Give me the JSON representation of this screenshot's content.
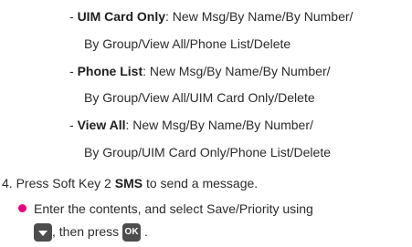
{
  "items": [
    {
      "term": "UIM Card Only",
      "line1": ": New Msg/By Name/By Number/",
      "line2": "By Group/View All/Phone List/Delete"
    },
    {
      "term": "Phone List",
      "line1": ": New Msg/By Name/By Number/",
      "line2": "By Group/View All/UIM Card Only/Delete"
    },
    {
      "term": "View All",
      "line1": ": New Msg/By Name/By Number/",
      "line2": "By Group/UIM Card Only/Phone List/Delete"
    }
  ],
  "dash": "-",
  "step": {
    "number": "4.",
    "prefix": "Press Soft Key 2 ",
    "key_label": "SMS",
    "suffix": " to send a message."
  },
  "bullet": {
    "line1": "Enter the contents, and select Save/Priority using",
    "line2_mid": ", then press",
    "line2_end": ".",
    "down_key": "down-arrow-key-icon",
    "ok_key_label": "OK",
    "bullet_color": "#e6007e"
  }
}
